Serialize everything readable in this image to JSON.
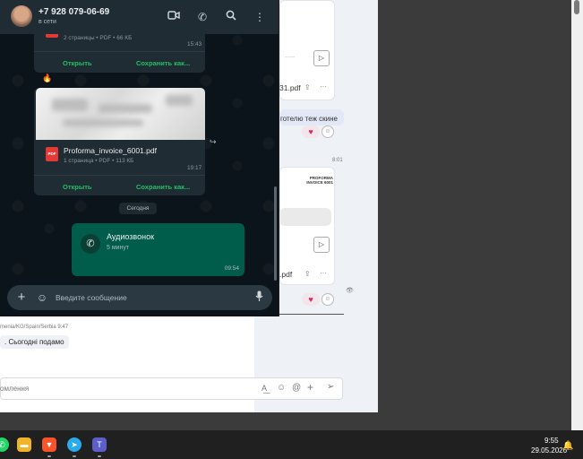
{
  "chat": {
    "contact_name": "+7 928 079-06-69",
    "contact_status": "в сети",
    "file1": {
      "meta": "2 страницы • PDF • 66 КБ",
      "time": "15:43",
      "open": "Открыть",
      "save": "Сохранить как..."
    },
    "reaction": "🔥",
    "file2": {
      "name": "Proforma_invoice_6001.pdf",
      "meta": "1 страница • PDF • 113 КБ",
      "time": "19:17",
      "open": "Открыть",
      "save": "Сохранить как..."
    },
    "date_separator": "Сегодня",
    "call": {
      "title": "Аудиозвонок",
      "duration": "5 минут",
      "time": "09:54"
    },
    "composer_placeholder": "Введите сообщение"
  },
  "background_app": {
    "doc1_name": "31.pdf",
    "message_text": "готелю теж скине",
    "time_label": "8:01",
    "doc2_title": "PROFORMA INVOICE 6001",
    "doc2_name": ".pdf",
    "sender_line": "menia/KG/Spain/Serbia  9:47",
    "reply_text": ". Сьогодні подамо",
    "input_placeholder": "омлення"
  },
  "taskbar": {
    "time": "9:55",
    "date": "29.05.2026"
  },
  "colors": {
    "chat_bg": "#0b141a",
    "header_bg": "#202c33",
    "accent_green": "#21c063",
    "outgoing_bubble": "#005c4b"
  }
}
